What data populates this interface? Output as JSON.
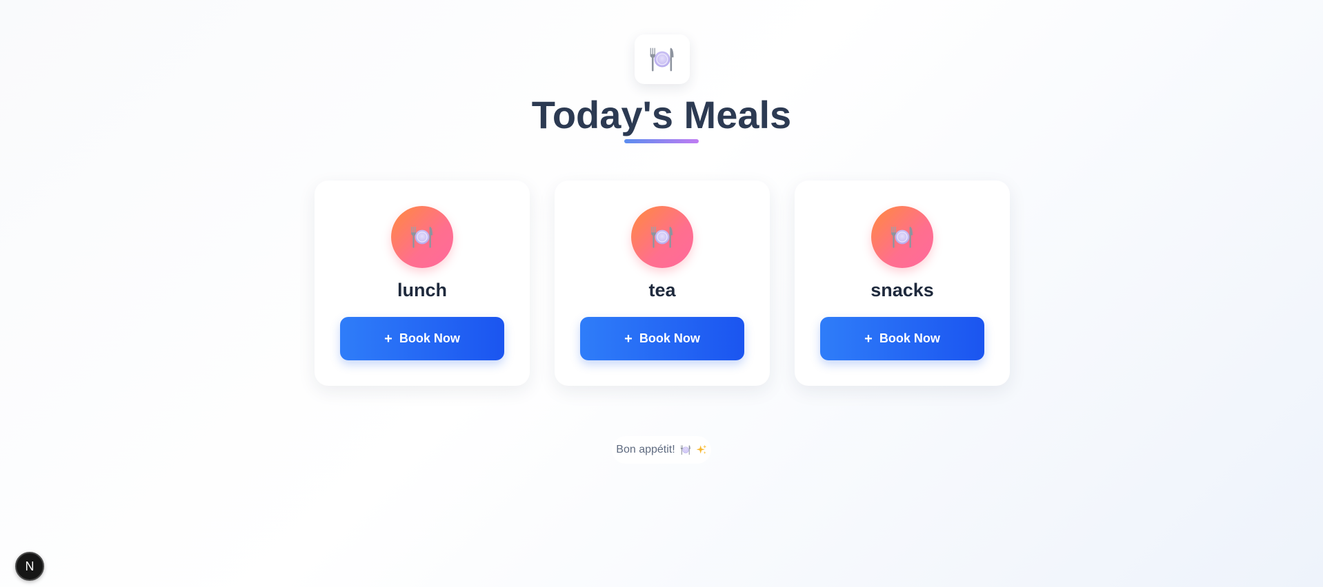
{
  "header": {
    "icon": "plate-cutlery-icon",
    "title": "Today's Meals",
    "underline_gradient": [
      "#5b8def",
      "#c07cf2"
    ]
  },
  "meals": [
    {
      "name": "lunch",
      "icon": "plate-cutlery-icon",
      "button_plus": "+",
      "button_label": "Book Now"
    },
    {
      "name": "tea",
      "icon": "plate-cutlery-icon",
      "button_plus": "+",
      "button_label": "Book Now"
    },
    {
      "name": "snacks",
      "icon": "plate-cutlery-icon",
      "button_plus": "+",
      "button_label": "Book Now"
    }
  ],
  "footer": {
    "text": "Bon appétit!",
    "icons": [
      "plate-cutlery-icon",
      "sparkles-icon"
    ]
  },
  "dev_badge": {
    "letter": "N",
    "icon": "nextjs-logo-icon"
  },
  "colors": {
    "accent_button": "#2f7df9",
    "icon_circle": "#ff7a6e",
    "title": "#2c3a52"
  }
}
